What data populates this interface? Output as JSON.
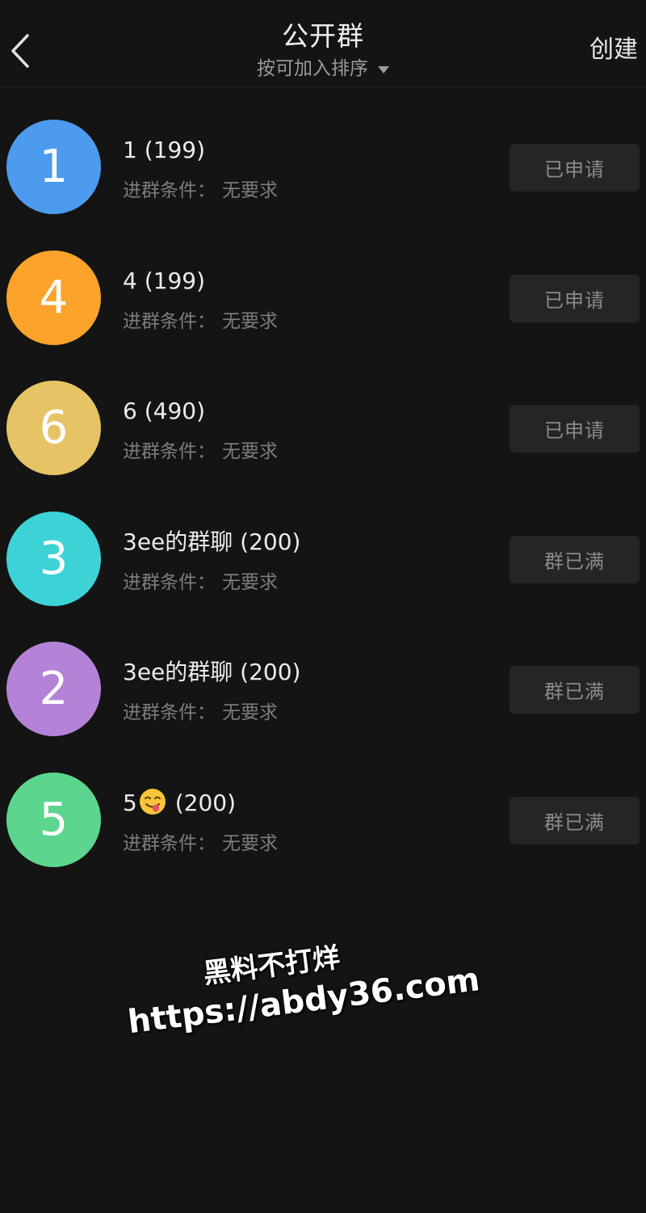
{
  "header": {
    "title": "公开群",
    "sort_label": "按可加入排序",
    "create_label": "创建"
  },
  "groups": [
    {
      "avatar": "1",
      "color": "#4c9bef",
      "name": "1 (199)",
      "cond_label": "进群条件：",
      "cond_value": "无要求",
      "action": "已申请"
    },
    {
      "avatar": "4",
      "color": "#fba32a",
      "name": "4 (199)",
      "cond_label": "进群条件：",
      "cond_value": "无要求",
      "action": "已申请"
    },
    {
      "avatar": "6",
      "color": "#e6c465",
      "name": "6 (490)",
      "cond_label": "进群条件：",
      "cond_value": "无要求",
      "action": "已申请"
    },
    {
      "avatar": "3",
      "color": "#3dd2d6",
      "name": "3ee的群聊 (200)",
      "cond_label": "进群条件：",
      "cond_value": "无要求",
      "action": "群已满"
    },
    {
      "avatar": "2",
      "color": "#b483d8",
      "name": "3ee的群聊 (200)",
      "cond_label": "进群条件：",
      "cond_value": "无要求",
      "action": "群已满"
    },
    {
      "avatar": "5",
      "color": "#5cd68e",
      "name_prefix": "5",
      "name_emoji": "smiling-face-with-tongue-icon",
      "name_suffix": " (200)",
      "cond_label": "进群条件：",
      "cond_value": "无要求",
      "action": "群已满"
    }
  ],
  "watermark": {
    "line1": "黑料不打烊",
    "line2": "https://abdy36.com"
  }
}
